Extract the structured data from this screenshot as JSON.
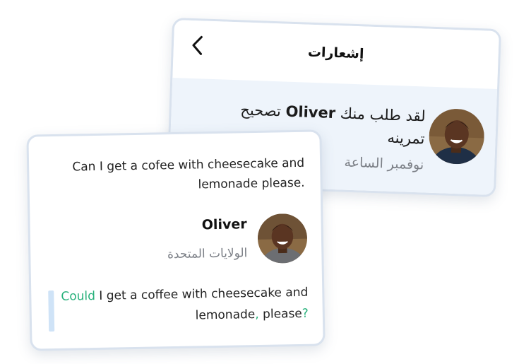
{
  "notifications": {
    "title": "إشعارات",
    "message_prefix": "لقد طلب منك",
    "message_name": "Oliver",
    "message_suffix": "تصحيح تمرينه",
    "date": "نوفمبر الساعة"
  },
  "correction": {
    "original_sentence": "Can I get a cofee with cheesecake and lemonade please.",
    "user_name": "Oliver",
    "user_country": "الولايات المتحدة",
    "corrected_parts": {
      "p1": "Could",
      "p2": " I get a cof",
      "p3": "f",
      "p4": "ee with cheesecake and lemonade",
      "p5": ",",
      "p6": " please",
      "p7": "?"
    }
  },
  "colors": {
    "correction_highlight": "#26b07a",
    "card_border": "#d9e2ee",
    "notification_bg": "#eef4fb"
  }
}
